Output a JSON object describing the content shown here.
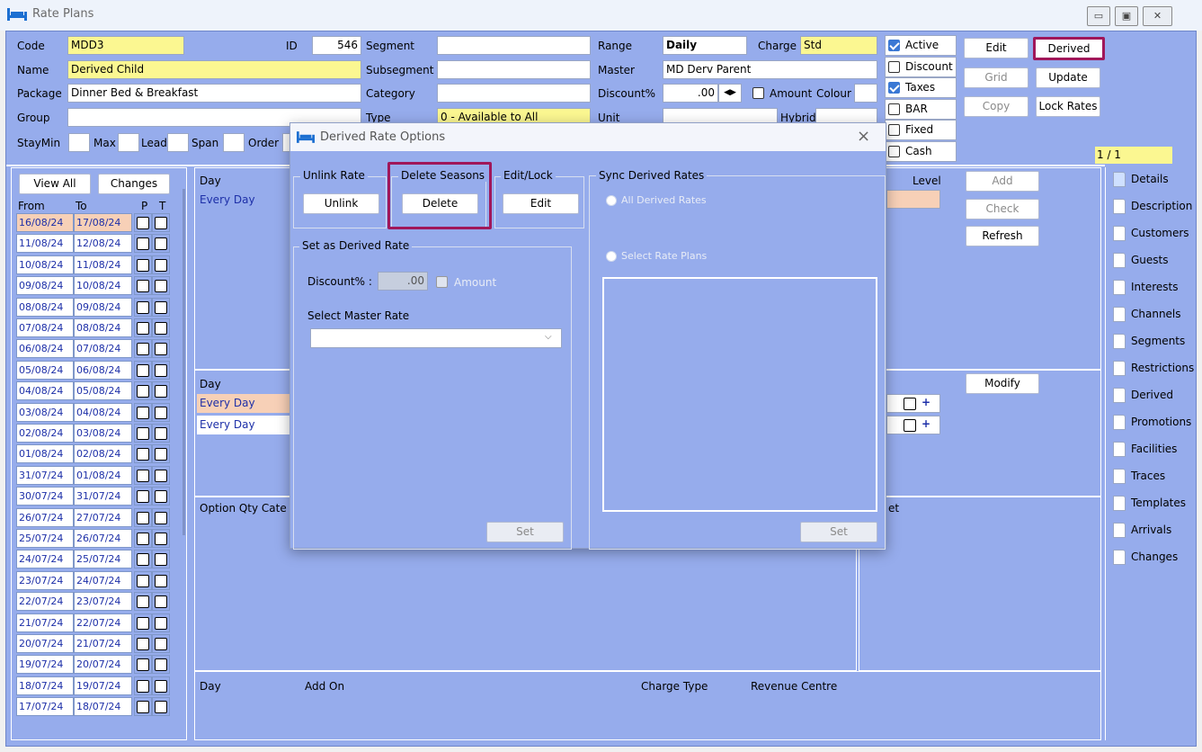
{
  "window": {
    "title": "Rate Plans",
    "min_icon": "minimize-icon",
    "max_icon": "maximize-icon",
    "close_icon": "close-icon"
  },
  "header": {
    "code_label": "Code",
    "code_value": "MDD3",
    "id_label": "ID",
    "id_value": "546",
    "name_label": "Name",
    "name_value": "Derived Child",
    "package_label": "Package",
    "package_value": "Dinner Bed & Breakfast",
    "group_label": "Group",
    "group_value": "",
    "staymin_label": "StayMin",
    "max_label": "Max",
    "lead_label": "Lead",
    "span_label": "Span",
    "order_label": "Order",
    "segment_label": "Segment",
    "subsegment_label": "Subsegment",
    "category_label": "Category",
    "type_label": "Type",
    "type_value": "0 - Available to All",
    "range_label": "Range",
    "range_value": "Daily",
    "charge_label": "Charge",
    "charge_value": "Std",
    "master_label": "Master",
    "master_value": "MD Derv Parent",
    "discount_label": "Discount%",
    "discount_value": ".00",
    "amount_label": "Amount",
    "colour_label": "Colour",
    "unit_label": "Unit",
    "hybrid_label": "Hybrid"
  },
  "flags": [
    {
      "label": "Active",
      "checked": true
    },
    {
      "label": "Discount",
      "checked": false
    },
    {
      "label": "Taxes",
      "checked": true
    },
    {
      "label": "BAR",
      "checked": false
    },
    {
      "label": "Fixed",
      "checked": false
    },
    {
      "label": "Cash",
      "checked": false
    }
  ],
  "actions": {
    "edit": "Edit",
    "derived": "Derived",
    "grid": "Grid",
    "update": "Update",
    "copy": "Copy",
    "lock_rates": "Lock Rates",
    "page": "1 / 1"
  },
  "dates": {
    "view_all": "View All",
    "changes": "Changes",
    "col_from": "From",
    "col_to": "To",
    "col_p": "P",
    "col_t": "T",
    "rows": [
      {
        "from": "16/08/24",
        "to": "17/08/24"
      },
      {
        "from": "11/08/24",
        "to": "12/08/24"
      },
      {
        "from": "10/08/24",
        "to": "11/08/24"
      },
      {
        "from": "09/08/24",
        "to": "10/08/24"
      },
      {
        "from": "08/08/24",
        "to": "09/08/24"
      },
      {
        "from": "07/08/24",
        "to": "08/08/24"
      },
      {
        "from": "06/08/24",
        "to": "07/08/24"
      },
      {
        "from": "05/08/24",
        "to": "06/08/24"
      },
      {
        "from": "04/08/24",
        "to": "05/08/24"
      },
      {
        "from": "03/08/24",
        "to": "04/08/24"
      },
      {
        "from": "02/08/24",
        "to": "03/08/24"
      },
      {
        "from": "01/08/24",
        "to": "02/08/24"
      },
      {
        "from": "31/07/24",
        "to": "01/08/24"
      },
      {
        "from": "30/07/24",
        "to": "31/07/24"
      },
      {
        "from": "26/07/24",
        "to": "27/07/24"
      },
      {
        "from": "25/07/24",
        "to": "26/07/24"
      },
      {
        "from": "24/07/24",
        "to": "25/07/24"
      },
      {
        "from": "23/07/24",
        "to": "24/07/24"
      },
      {
        "from": "22/07/24",
        "to": "23/07/24"
      },
      {
        "from": "21/07/24",
        "to": "22/07/24"
      },
      {
        "from": "20/07/24",
        "to": "21/07/24"
      },
      {
        "from": "19/07/24",
        "to": "20/07/24"
      },
      {
        "from": "18/07/24",
        "to": "19/07/24"
      },
      {
        "from": "17/07/24",
        "to": "18/07/24"
      }
    ]
  },
  "grid1": {
    "day_header": "Day",
    "row": "Every Day",
    "level_header": "Level",
    "add": "Add",
    "check": "Check",
    "refresh": "Refresh"
  },
  "grid2": {
    "day_header": "Day",
    "rows": [
      "Every Day",
      "Every Day"
    ],
    "modify": "Modify",
    "plus": "+"
  },
  "grid3": {
    "header": "Option  Qty Cate",
    "right_header": "et"
  },
  "grid4": {
    "day": "Day",
    "add_on": "Add On",
    "charge_type": "Charge Type",
    "revenue_centre": "Revenue Centre"
  },
  "tabs": [
    "Details",
    "Description",
    "Customers",
    "Guests",
    "Interests",
    "Channels",
    "Segments",
    "Restrictions",
    "Derived",
    "Promotions",
    "Facilities",
    "Traces",
    "Templates",
    "Arrivals",
    "Changes"
  ],
  "dialog": {
    "title": "Derived Rate Options",
    "unlink_group": "Unlink Rate",
    "unlink_btn": "Unlink",
    "delete_group": "Delete Seasons",
    "delete_btn": "Delete",
    "edit_group": "Edit/Lock",
    "edit_btn": "Edit",
    "set_group": "Set as Derived Rate",
    "discount_label": "Discount% :",
    "discount_value": ".00",
    "amount_label": "Amount",
    "master_label": "Select Master Rate",
    "master_value": "",
    "set_btn": "Set",
    "sync_group": "Sync Derived Rates",
    "all_derived": "All Derived Rates",
    "select_plans": "Select Rate Plans",
    "sync_set_btn": "Set"
  },
  "colors": {
    "panel": "#96acec",
    "highlight": "#a0175a",
    "yellow_field": "#fbf791",
    "date_text": "#1d2fa8"
  }
}
